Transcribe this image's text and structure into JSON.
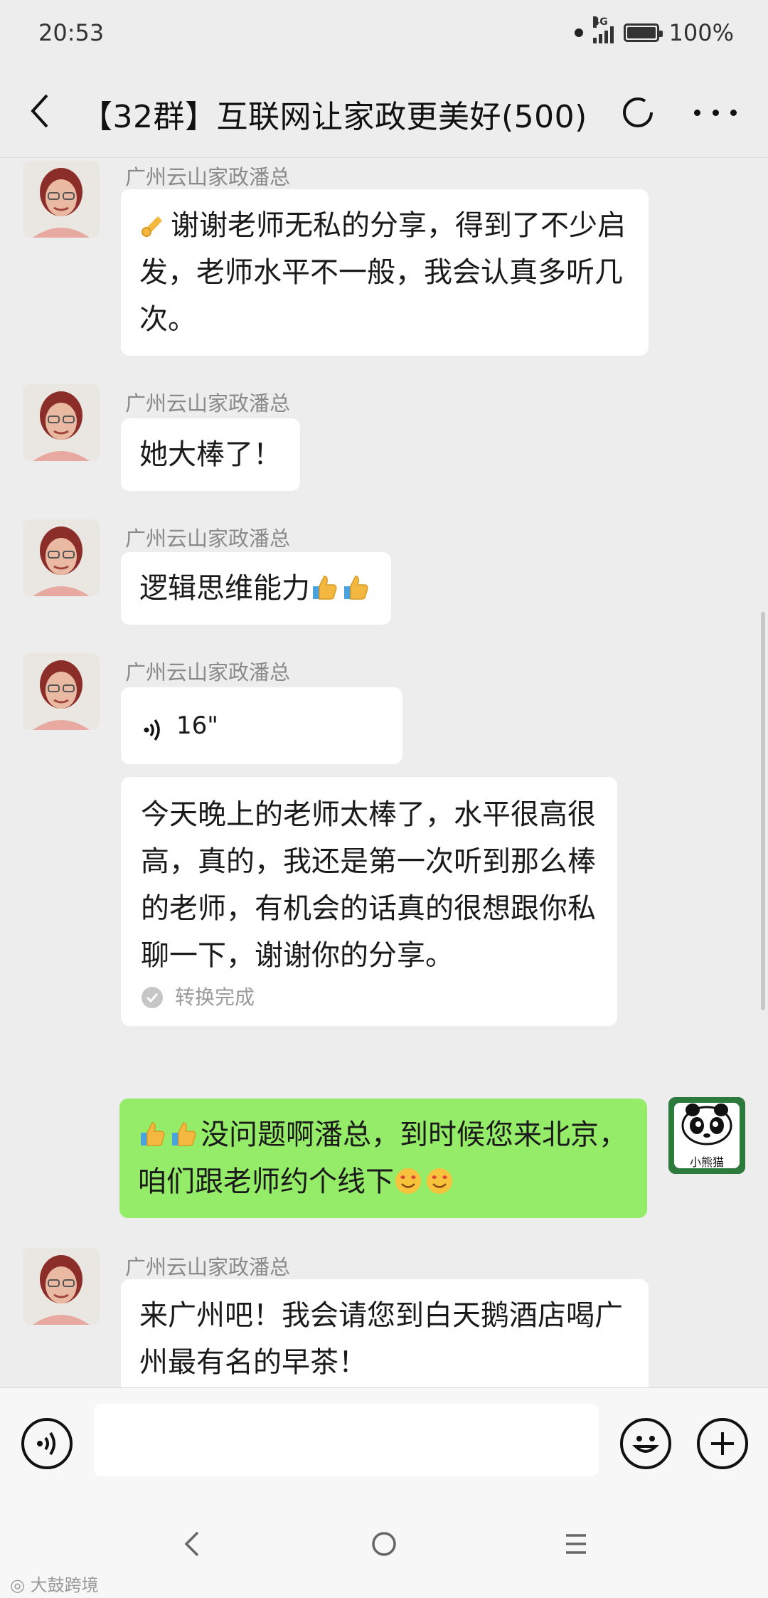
{
  "status_bar": {
    "time": "20:53",
    "network": "4G",
    "battery": "100%",
    "battery_level": 1.0
  },
  "header": {
    "title": "【32群】互联网让家政更美好(500)",
    "back_icon": "back-arrow-icon",
    "loading_icon": "loading-spinner-icon",
    "more_icon": "more-dots-icon"
  },
  "messages": [
    {
      "sender": "广州云山家政潘总",
      "type": "text",
      "lead_emoji": "ok-hand-emoji",
      "text": "谢谢老师无私的分享，得到了不少启发，老师水平不一般，我会认真多听几次。"
    },
    {
      "sender": "广州云山家政潘总",
      "type": "text",
      "text": "她大棒了！"
    },
    {
      "sender": "广州云山家政潘总",
      "type": "text",
      "text": "逻辑思维能力",
      "trailing_emojis": [
        "thumbs-up-emoji",
        "thumbs-up-emoji"
      ]
    },
    {
      "sender": "广州云山家政潘总",
      "type": "voice",
      "duration": "16\"",
      "transcript": "今天晚上的老师太棒了，水平很高很高，真的，我还是第一次听到那么棒的老师，有机会的话真的很想跟你私聊一下，谢谢你的分享。",
      "transcript_status": "转换完成"
    },
    {
      "sender": "self",
      "avatar_label": "小熊猫",
      "type": "text",
      "lead_emojis": [
        "thumbs-up-emoji",
        "thumbs-up-emoji"
      ],
      "text": "没问题啊潘总，到时候您来北京，咱们跟老师约个线下",
      "trailing_emojis": [
        "heart-eyes-emoji",
        "heart-eyes-emoji"
      ]
    },
    {
      "sender": "广州云山家政潘总",
      "type": "text",
      "text": "来广州吧！我会请您到白天鹅酒店喝广州最有名的早茶！"
    }
  ],
  "input_bar": {
    "voice_icon": "voice-input-icon",
    "text_value": "",
    "emoji_icon": "emoji-icon",
    "plus_icon": "plus-icon"
  },
  "nav_bar": {
    "back_icon": "nav-back-icon",
    "home_icon": "nav-home-icon",
    "menu_icon": "nav-menu-icon"
  },
  "watermark": "大鼓跨境",
  "colors": {
    "background": "#ededed",
    "bubble_self": "#95ec69",
    "bubble_other": "#ffffff",
    "sender_name": "#8a8a8a"
  }
}
